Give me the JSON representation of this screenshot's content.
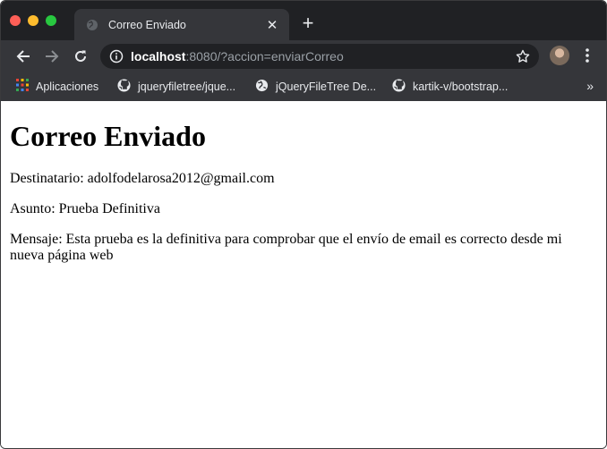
{
  "browser": {
    "tab": {
      "title": "Correo Enviado",
      "close_label": "✕"
    },
    "new_tab_label": "+",
    "address": {
      "host": "localhost",
      "rest": ":8080/?accion=enviarCorreo"
    },
    "bookmarks": [
      {
        "label": "Aplicaciones",
        "icon": "apps-grid-icon"
      },
      {
        "label": "jqueryfiletree/jque...",
        "icon": "github-icon"
      },
      {
        "label": "jQueryFileTree De...",
        "icon": "globe-icon"
      },
      {
        "label": "kartik-v/bootstrap...",
        "icon": "github-icon"
      }
    ],
    "bookmarks_more": "»"
  },
  "page": {
    "heading": "Correo Enviado",
    "destinatario": "Destinatario: adolfodelarosa2012@gmail.com",
    "asunto": "Asunto: Prueba Definitiva",
    "mensaje": "Mensaje: Esta prueba es la definitiva para comprobar que el envío de email es correcto desde mi nueva página web"
  },
  "colors": {
    "frame_dark": "#202124",
    "toolbar": "#35363a",
    "close_red": "#fe5f57",
    "minimize_yellow": "#febc2e",
    "maximize_green": "#28c840"
  }
}
